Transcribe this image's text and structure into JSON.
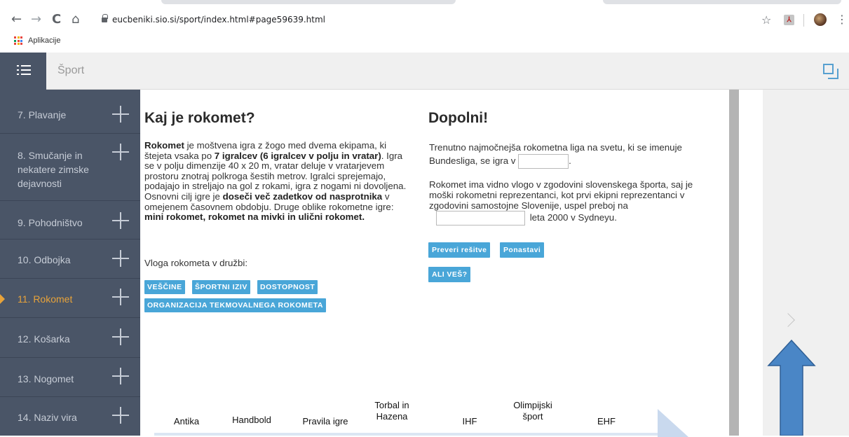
{
  "browser": {
    "url": "eucbeniki.sio.si/sport/index.html#page59639.html",
    "bookmark_apps": "Aplikacije",
    "back_icon": "←",
    "forward_icon": "→",
    "reload_icon": "C",
    "home_icon": "⌂",
    "star_icon": "☆",
    "menu_icon": "⋮"
  },
  "header": {
    "title": "Šport"
  },
  "sidebar": {
    "items": [
      {
        "label": "7. Plavanje"
      },
      {
        "label": "8. Smučanje in nekatere zimske dejavnosti"
      },
      {
        "label": "9. Pohodništvo"
      },
      {
        "label": "10. Odbojka"
      },
      {
        "label": "11. Rokomet"
      },
      {
        "label": "12. Košarka"
      },
      {
        "label": "13. Nogomet"
      },
      {
        "label": "14. Naziv vira"
      }
    ],
    "active_index": 4
  },
  "left": {
    "heading": "Kaj je rokomet?",
    "p_rokomet": "Rokomet",
    "p_1": " je moštvena igra z žogo med dvema ekipama, ki štejeta vsaka po ",
    "p_bold1": "7 igralcev (6 igralcev v polju in vratar)",
    "p_2": ". Igra se v polju dimenzije 40 x 20 m, vratar deluje v vratarjevem prostoru znotraj polkroga šestih metrov. Igralci sprejemajo, podajajo in streljajo na gol z rokami, igra z nogami ni dovoljena. Osnovni cilj igre je ",
    "p_bold2": "doseči več zadetkov od nasprotnika",
    "p_3": " v omejenem časovnem obdobju. Druge oblike rokometne igre: ",
    "p_bold3": "mini rokomet, rokomet na mivki in ulični rokomet.",
    "vloga": "Vloga rokometa v družbi:",
    "tags": [
      "VEŠČINE",
      "ŠPORTNI IZIV",
      "DOSTOPNOST",
      "ORGANIZACIJA TEKMOVALNEGA ROKOMETA"
    ]
  },
  "right": {
    "heading": "Dopolni!",
    "q1_text": "Trenutno najmočnejša rokometna liga na svetu, ki se imenuje Bundesliga, se igra v",
    "q1_after": ".",
    "q1_value": "",
    "q2_text": "Rokomet ima vidno vlogo v zgodovini slovenskega športa, saj je moški rokometni reprezentanci, kot prvi ekipni reprezentanci v zgodovini samostojne Slovenije, uspel preboj na",
    "q2_after": "leta 2000 v Sydneyu.",
    "q2_value": "",
    "check_button": "Preveri rešitve",
    "reset_button": "Ponastavi",
    "know_button": "ALI VEŠ?"
  },
  "timeline": {
    "labels": [
      "Antika",
      "Handbold",
      "Pravila igre",
      "Torbal in Hazena",
      "IHF",
      "Olimpijski šport",
      "EHF"
    ]
  },
  "colors": {
    "sidebar_bg": "#4a5567",
    "accent": "#49a6d8",
    "active": "#e8a33a",
    "annotation_arrow": "#4a86c6"
  }
}
